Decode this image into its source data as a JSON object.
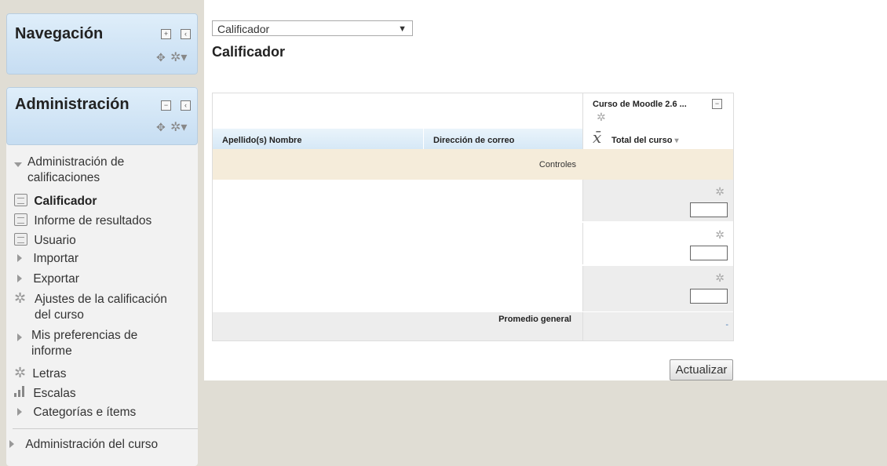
{
  "navigation": {
    "title": "Navegación"
  },
  "administration": {
    "title": "Administración",
    "section": "Administración de calificaciones",
    "items": [
      "Calificador",
      "Informe de resultados",
      "Usuario",
      "Importar",
      "Exportar",
      "Ajustes de la calificación del curso",
      "Mis preferencias de informe",
      "Letras",
      "Escalas",
      "Categorías e ítems"
    ],
    "course_admin": "Administración del curso"
  },
  "report_select": {
    "value": "Calificador"
  },
  "page": {
    "title": "Calificador"
  },
  "table": {
    "course_header": "Curso de Moodle 2.6 ...",
    "col_name": "Apellido(s) Nombre",
    "col_email": "Dirección de correo",
    "col_total": "Total del curso",
    "controls": "Controles",
    "average": "Promedio general",
    "average_value": "-"
  },
  "update_button": "Actualizar"
}
